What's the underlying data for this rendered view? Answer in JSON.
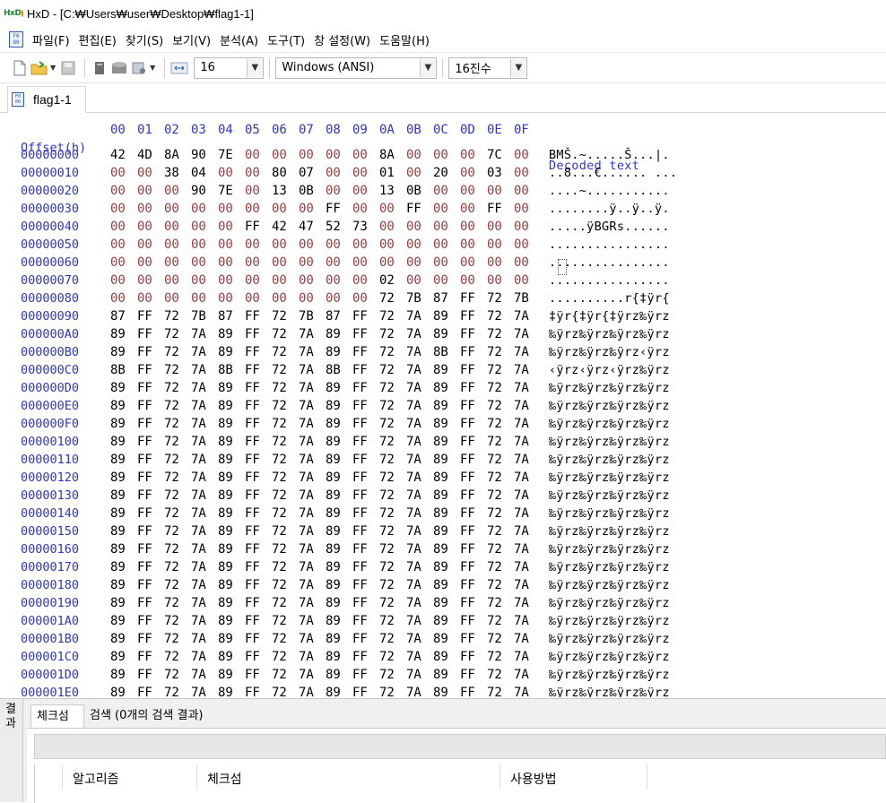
{
  "window": {
    "title": "HxD - [C:₩Users₩user₩Desktop₩flag1-1]",
    "app_icon_text": "HxD"
  },
  "menu": {
    "items": [
      "파일(F)",
      "편집(E)",
      "찾기(S)",
      "보기(V)",
      "분석(A)",
      "도구(T)",
      "창 설정(W)",
      "도움말(H)"
    ]
  },
  "toolbar": {
    "bytes_per_row": "16",
    "charset": "Windows (ANSI)",
    "offset_base": "16진수",
    "icons": [
      "new-file-icon",
      "open-file-icon",
      "save-icon",
      "readonly-icon",
      "disk-icon",
      "memory-icon",
      "bytes-per-row-icon"
    ]
  },
  "tabs": [
    {
      "label": "flag1-1"
    }
  ],
  "editor": {
    "offset_header": "Offset(h)",
    "column_headers": [
      "00",
      "01",
      "02",
      "03",
      "04",
      "05",
      "06",
      "07",
      "08",
      "09",
      "0A",
      "0B",
      "0C",
      "0D",
      "0E",
      "0F"
    ],
    "decoded_header": "Decoded text",
    "rows": [
      {
        "offset": "00000000",
        "bytes": [
          "42",
          "4D",
          "8A",
          "90",
          "7E",
          "00",
          "00",
          "00",
          "00",
          "00",
          "8A",
          "00",
          "00",
          "00",
          "7C",
          "00"
        ],
        "decoded": "BMŠ.~.....Š...|."
      },
      {
        "offset": "00000010",
        "bytes": [
          "00",
          "00",
          "38",
          "04",
          "00",
          "00",
          "80",
          "07",
          "00",
          "00",
          "01",
          "00",
          "20",
          "00",
          "03",
          "00"
        ],
        "decoded": "..8...€...... ..."
      },
      {
        "offset": "00000020",
        "bytes": [
          "00",
          "00",
          "00",
          "90",
          "7E",
          "00",
          "13",
          "0B",
          "00",
          "00",
          "13",
          "0B",
          "00",
          "00",
          "00",
          "00"
        ],
        "decoded": "....~..........."
      },
      {
        "offset": "00000030",
        "bytes": [
          "00",
          "00",
          "00",
          "00",
          "00",
          "00",
          "00",
          "00",
          "FF",
          "00",
          "00",
          "FF",
          "00",
          "00",
          "FF",
          "00"
        ],
        "decoded": "........ÿ..ÿ..ÿ."
      },
      {
        "offset": "00000040",
        "bytes": [
          "00",
          "00",
          "00",
          "00",
          "00",
          "FF",
          "42",
          "47",
          "52",
          "73",
          "00",
          "00",
          "00",
          "00",
          "00",
          "00"
        ],
        "decoded": ".....ÿBGRs......"
      },
      {
        "offset": "00000050",
        "bytes": [
          "00",
          "00",
          "00",
          "00",
          "00",
          "00",
          "00",
          "00",
          "00",
          "00",
          "00",
          "00",
          "00",
          "00",
          "00",
          "00"
        ],
        "decoded": "................"
      },
      {
        "offset": "00000060",
        "bytes": [
          "00",
          "00",
          "00",
          "00",
          "00",
          "00",
          "00",
          "00",
          "00",
          "00",
          "00",
          "00",
          "00",
          "00",
          "00",
          "00"
        ],
        "decoded": "................"
      },
      {
        "offset": "00000070",
        "bytes": [
          "00",
          "00",
          "00",
          "00",
          "00",
          "00",
          "00",
          "00",
          "00",
          "00",
          "02",
          "00",
          "00",
          "00",
          "00",
          "00"
        ],
        "decoded": "................"
      },
      {
        "offset": "00000080",
        "bytes": [
          "00",
          "00",
          "00",
          "00",
          "00",
          "00",
          "00",
          "00",
          "00",
          "00",
          "72",
          "7B",
          "87",
          "FF",
          "72",
          "7B"
        ],
        "decoded": "..........r{‡ÿr{"
      },
      {
        "offset": "00000090",
        "bytes": [
          "87",
          "FF",
          "72",
          "7B",
          "87",
          "FF",
          "72",
          "7B",
          "87",
          "FF",
          "72",
          "7A",
          "89",
          "FF",
          "72",
          "7A"
        ],
        "decoded": "‡ÿr{‡ÿr{‡ÿrz‰ÿrz"
      },
      {
        "offset": "000000A0",
        "bytes": [
          "89",
          "FF",
          "72",
          "7A",
          "89",
          "FF",
          "72",
          "7A",
          "89",
          "FF",
          "72",
          "7A",
          "89",
          "FF",
          "72",
          "7A"
        ],
        "decoded": "‰ÿrz‰ÿrz‰ÿrz‰ÿrz"
      },
      {
        "offset": "000000B0",
        "bytes": [
          "89",
          "FF",
          "72",
          "7A",
          "89",
          "FF",
          "72",
          "7A",
          "89",
          "FF",
          "72",
          "7A",
          "8B",
          "FF",
          "72",
          "7A"
        ],
        "decoded": "‰ÿrz‰ÿrz‰ÿrz‹ÿrz"
      },
      {
        "offset": "000000C0",
        "bytes": [
          "8B",
          "FF",
          "72",
          "7A",
          "8B",
          "FF",
          "72",
          "7A",
          "8B",
          "FF",
          "72",
          "7A",
          "89",
          "FF",
          "72",
          "7A"
        ],
        "decoded": "‹ÿrz‹ÿrz‹ÿrz‰ÿrz"
      },
      {
        "offset": "000000D0",
        "bytes": [
          "89",
          "FF",
          "72",
          "7A",
          "89",
          "FF",
          "72",
          "7A",
          "89",
          "FF",
          "72",
          "7A",
          "89",
          "FF",
          "72",
          "7A"
        ],
        "decoded": "‰ÿrz‰ÿrz‰ÿrz‰ÿrz"
      },
      {
        "offset": "000000E0",
        "bytes": [
          "89",
          "FF",
          "72",
          "7A",
          "89",
          "FF",
          "72",
          "7A",
          "89",
          "FF",
          "72",
          "7A",
          "89",
          "FF",
          "72",
          "7A"
        ],
        "decoded": "‰ÿrz‰ÿrz‰ÿrz‰ÿrz"
      },
      {
        "offset": "000000F0",
        "bytes": [
          "89",
          "FF",
          "72",
          "7A",
          "89",
          "FF",
          "72",
          "7A",
          "89",
          "FF",
          "72",
          "7A",
          "89",
          "FF",
          "72",
          "7A"
        ],
        "decoded": "‰ÿrz‰ÿrz‰ÿrz‰ÿrz"
      },
      {
        "offset": "00000100",
        "bytes": [
          "89",
          "FF",
          "72",
          "7A",
          "89",
          "FF",
          "72",
          "7A",
          "89",
          "FF",
          "72",
          "7A",
          "89",
          "FF",
          "72",
          "7A"
        ],
        "decoded": "‰ÿrz‰ÿrz‰ÿrz‰ÿrz"
      },
      {
        "offset": "00000110",
        "bytes": [
          "89",
          "FF",
          "72",
          "7A",
          "89",
          "FF",
          "72",
          "7A",
          "89",
          "FF",
          "72",
          "7A",
          "89",
          "FF",
          "72",
          "7A"
        ],
        "decoded": "‰ÿrz‰ÿrz‰ÿrz‰ÿrz"
      },
      {
        "offset": "00000120",
        "bytes": [
          "89",
          "FF",
          "72",
          "7A",
          "89",
          "FF",
          "72",
          "7A",
          "89",
          "FF",
          "72",
          "7A",
          "89",
          "FF",
          "72",
          "7A"
        ],
        "decoded": "‰ÿrz‰ÿrz‰ÿrz‰ÿrz"
      },
      {
        "offset": "00000130",
        "bytes": [
          "89",
          "FF",
          "72",
          "7A",
          "89",
          "FF",
          "72",
          "7A",
          "89",
          "FF",
          "72",
          "7A",
          "89",
          "FF",
          "72",
          "7A"
        ],
        "decoded": "‰ÿrz‰ÿrz‰ÿrz‰ÿrz"
      },
      {
        "offset": "00000140",
        "bytes": [
          "89",
          "FF",
          "72",
          "7A",
          "89",
          "FF",
          "72",
          "7A",
          "89",
          "FF",
          "72",
          "7A",
          "89",
          "FF",
          "72",
          "7A"
        ],
        "decoded": "‰ÿrz‰ÿrz‰ÿrz‰ÿrz"
      },
      {
        "offset": "00000150",
        "bytes": [
          "89",
          "FF",
          "72",
          "7A",
          "89",
          "FF",
          "72",
          "7A",
          "89",
          "FF",
          "72",
          "7A",
          "89",
          "FF",
          "72",
          "7A"
        ],
        "decoded": "‰ÿrz‰ÿrz‰ÿrz‰ÿrz"
      },
      {
        "offset": "00000160",
        "bytes": [
          "89",
          "FF",
          "72",
          "7A",
          "89",
          "FF",
          "72",
          "7A",
          "89",
          "FF",
          "72",
          "7A",
          "89",
          "FF",
          "72",
          "7A"
        ],
        "decoded": "‰ÿrz‰ÿrz‰ÿrz‰ÿrz"
      },
      {
        "offset": "00000170",
        "bytes": [
          "89",
          "FF",
          "72",
          "7A",
          "89",
          "FF",
          "72",
          "7A",
          "89",
          "FF",
          "72",
          "7A",
          "89",
          "FF",
          "72",
          "7A"
        ],
        "decoded": "‰ÿrz‰ÿrz‰ÿrz‰ÿrz"
      },
      {
        "offset": "00000180",
        "bytes": [
          "89",
          "FF",
          "72",
          "7A",
          "89",
          "FF",
          "72",
          "7A",
          "89",
          "FF",
          "72",
          "7A",
          "89",
          "FF",
          "72",
          "7A"
        ],
        "decoded": "‰ÿrz‰ÿrz‰ÿrz‰ÿrz"
      },
      {
        "offset": "00000190",
        "bytes": [
          "89",
          "FF",
          "72",
          "7A",
          "89",
          "FF",
          "72",
          "7A",
          "89",
          "FF",
          "72",
          "7A",
          "89",
          "FF",
          "72",
          "7A"
        ],
        "decoded": "‰ÿrz‰ÿrz‰ÿrz‰ÿrz"
      },
      {
        "offset": "000001A0",
        "bytes": [
          "89",
          "FF",
          "72",
          "7A",
          "89",
          "FF",
          "72",
          "7A",
          "89",
          "FF",
          "72",
          "7A",
          "89",
          "FF",
          "72",
          "7A"
        ],
        "decoded": "‰ÿrz‰ÿrz‰ÿrz‰ÿrz"
      },
      {
        "offset": "000001B0",
        "bytes": [
          "89",
          "FF",
          "72",
          "7A",
          "89",
          "FF",
          "72",
          "7A",
          "89",
          "FF",
          "72",
          "7A",
          "89",
          "FF",
          "72",
          "7A"
        ],
        "decoded": "‰ÿrz‰ÿrz‰ÿrz‰ÿrz"
      },
      {
        "offset": "000001C0",
        "bytes": [
          "89",
          "FF",
          "72",
          "7A",
          "89",
          "FF",
          "72",
          "7A",
          "89",
          "FF",
          "72",
          "7A",
          "89",
          "FF",
          "72",
          "7A"
        ],
        "decoded": "‰ÿrz‰ÿrz‰ÿrz‰ÿrz"
      },
      {
        "offset": "000001D0",
        "bytes": [
          "89",
          "FF",
          "72",
          "7A",
          "89",
          "FF",
          "72",
          "7A",
          "89",
          "FF",
          "72",
          "7A",
          "89",
          "FF",
          "72",
          "7A"
        ],
        "decoded": "‰ÿrz‰ÿrz‰ÿrz‰ÿrz"
      },
      {
        "offset": "000001E0",
        "bytes": [
          "89",
          "FF",
          "72",
          "7A",
          "89",
          "FF",
          "72",
          "7A",
          "89",
          "FF",
          "72",
          "7A",
          "89",
          "FF",
          "72",
          "7A"
        ],
        "decoded": "‰ÿrz‰ÿrz‰ÿrz‰ÿrz"
      }
    ]
  },
  "results_panel": {
    "side_label": "결과",
    "tabs": [
      "체크섬",
      "검색 (0개의 검색 결과)"
    ],
    "columns": [
      "알고리즘",
      "체크섬",
      "사용방법"
    ]
  },
  "colors": {
    "offset_text": "#2c35c7",
    "zero_byte": "#9b3b3b",
    "nonzero_byte": "#000000"
  }
}
